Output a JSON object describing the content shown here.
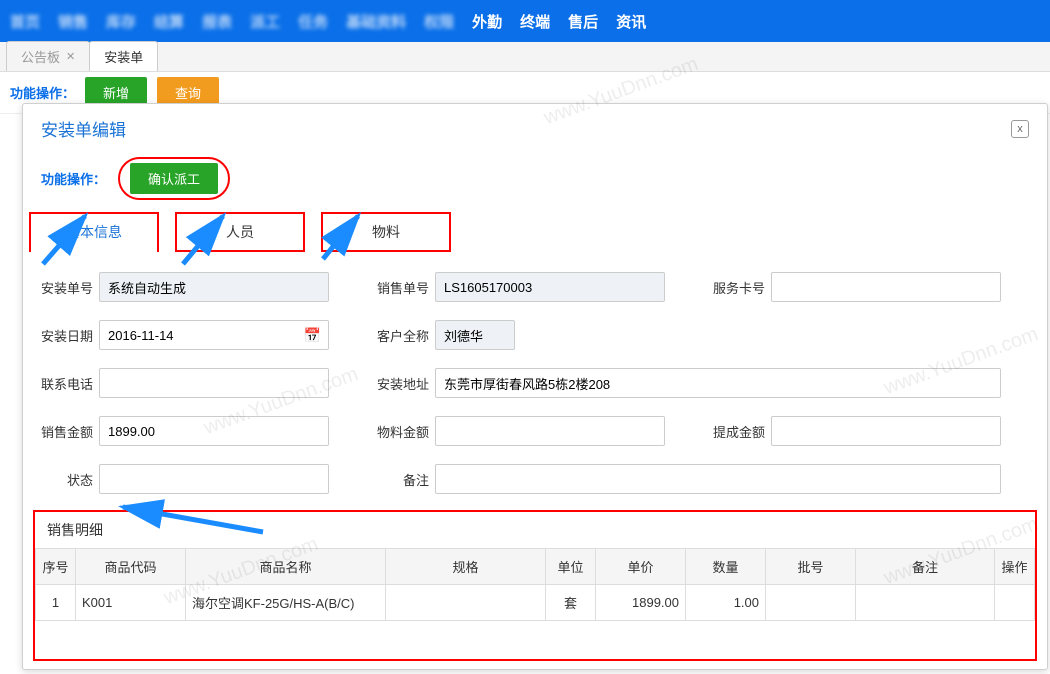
{
  "nav": [
    "首页",
    "销售",
    "库存",
    "结算",
    "报表",
    "派工",
    "任务",
    "基础资料",
    "权限",
    "外勤",
    "终端",
    "售后",
    "资讯"
  ],
  "tabs": {
    "board": "公告板",
    "install": "安装单"
  },
  "below": {
    "op": "功能操作：",
    "add": "新增",
    "query": "查询"
  },
  "modal": {
    "title": "安装单编辑",
    "close": "x",
    "ops": "功能操作：",
    "confirm": "确认派工",
    "innerTabs": {
      "basic": "基本信息",
      "staff": "人员",
      "material": "物料"
    }
  },
  "form": {
    "orderNoLabel": "安装单号",
    "orderNo": "系统自动生成",
    "saleNoLabel": "销售单号",
    "saleNo": "LS1605170003",
    "cardLabel": "服务卡号",
    "card": "",
    "dateLabel": "安装日期",
    "date": "2016-11-14",
    "custLabel": "客户全称",
    "cust": "刘德华",
    "phoneLabel": "联系电话",
    "phone": "",
    "addrLabel": "安装地址",
    "addr": "东莞市厚街春风路5栋2楼208",
    "saleAmtLabel": "销售金额",
    "saleAmt": "1899.00",
    "matAmtLabel": "物料金额",
    "matAmt": "",
    "bonusLabel": "提成金额",
    "bonus": "",
    "statusLabel": "状态",
    "status": "",
    "remarkLabel": "备注",
    "remark": ""
  },
  "detail": {
    "title": "销售明细",
    "cols": {
      "no": "序号",
      "code": "商品代码",
      "name": "商品名称",
      "spec": "规格",
      "unit": "单位",
      "price": "单价",
      "qty": "数量",
      "batch": "批号",
      "remark": "备注",
      "op": "操作"
    },
    "rows": [
      {
        "no": "1",
        "code": "K001",
        "name": "海尔空调KF-25G/HS-A(B/C)",
        "spec": "",
        "unit": "套",
        "price": "1899.00",
        "qty": "1.00",
        "batch": "",
        "remark": "",
        "op": ""
      }
    ]
  },
  "watermark": "www.YuuDnn.com"
}
